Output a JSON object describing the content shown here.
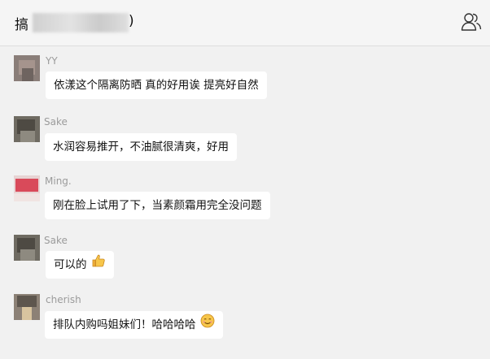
{
  "header": {
    "title_prefix": "搞",
    "title_suffix": ")"
  },
  "messages": [
    {
      "name": "YY",
      "text": "依漾这个隔离防晒 真的好用诶 提亮好自然"
    },
    {
      "name": "Sake",
      "text": "水润容易推开，不油腻很清爽，好用"
    },
    {
      "name": "Ming.",
      "text": "刚在脸上试用了下，当素颜霜用完全没问题"
    },
    {
      "name": "Sake",
      "text": "可以的",
      "emoji": "thumbs-up-emoji"
    },
    {
      "name": "cherish",
      "text": "排队内购吗姐妹们！哈哈哈哈",
      "emoji": "smiling-face-emoji"
    }
  ],
  "colors": {
    "background": "#f1f1f1",
    "bubble": "#ffffff",
    "name": "#9b9b9b"
  }
}
